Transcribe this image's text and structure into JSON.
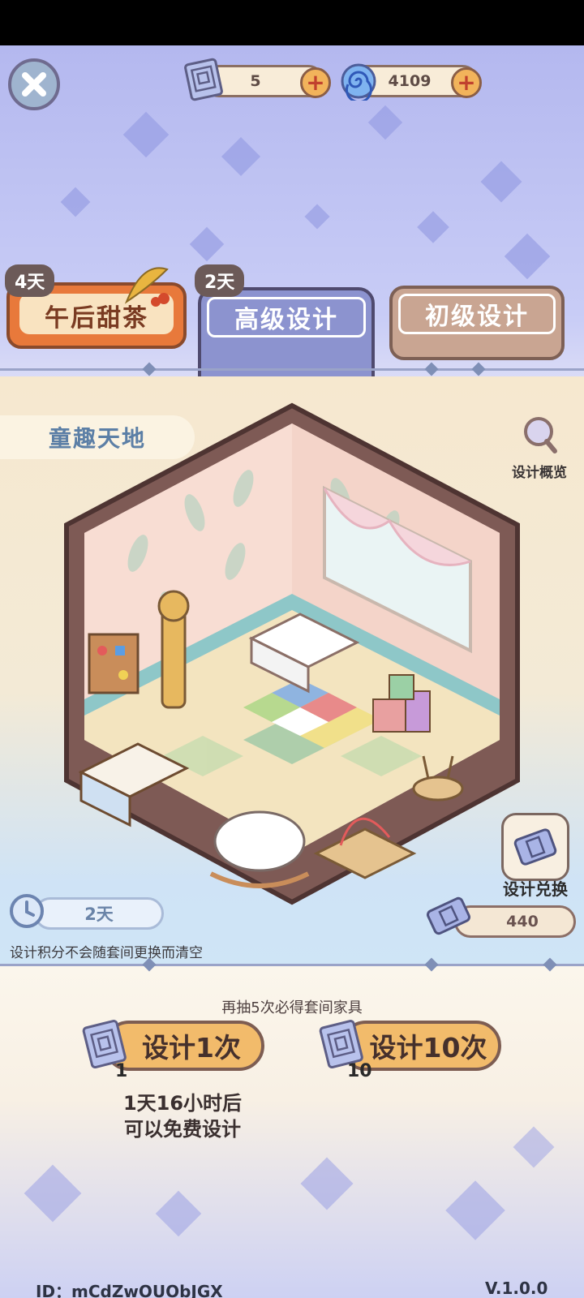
{
  "top_bar": {
    "tickets_value": "5",
    "gems_value": "4109",
    "icons": [
      "close-icon",
      "blueprint-ticket-icon",
      "swirl-gem-icon",
      "plus-icon"
    ]
  },
  "tabs": [
    {
      "label": "午后甜茶",
      "badge": "4天"
    },
    {
      "label": "高级设计",
      "badge": "2天",
      "selected": true
    },
    {
      "label": "初级设计"
    }
  ],
  "room": {
    "name": "童趣天地",
    "overview_label": "设计概览",
    "timer": "2天",
    "note": "设计积分不会随套间更换而清空",
    "exchange_label": "设计兑换",
    "points_value": "440"
  },
  "draw": {
    "hint": "再抽5次必得套间家具",
    "single_label": "设计1次",
    "single_count": "1",
    "ten_label": "设计10次",
    "ten_count": "10",
    "free_line1": "1天16小时后",
    "free_line2": "可以免费设计"
  },
  "footer": {
    "id_text": "ID：mCdZwOUObJGX",
    "version": "V.1.0.0"
  },
  "colors": {
    "accent_orange": "#f2bb6b",
    "tab_selected": "#8c93cf",
    "tab_brown": "#c9a592",
    "tab_event": "#e8793b"
  }
}
